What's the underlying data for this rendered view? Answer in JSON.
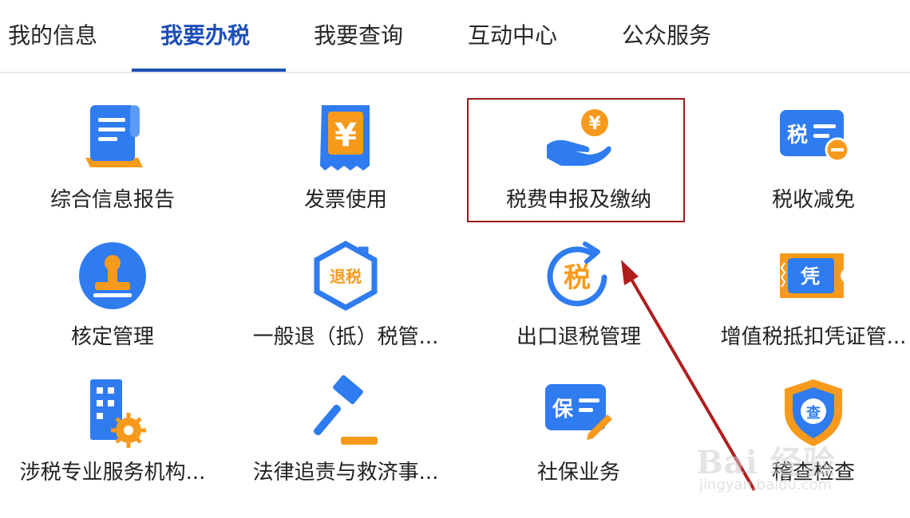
{
  "tabs": [
    {
      "label": "我的信息",
      "active": false
    },
    {
      "label": "我要办税",
      "active": true
    },
    {
      "label": "我要查询",
      "active": false
    },
    {
      "label": "互动中心",
      "active": false
    },
    {
      "label": "公众服务",
      "active": false
    }
  ],
  "tiles": [
    {
      "label": "综合信息报告",
      "icon": "report-document-icon"
    },
    {
      "label": "发票使用",
      "icon": "invoice-receipt-icon",
      "icon_text": "¥"
    },
    {
      "label": "税费申报及缴纳",
      "icon": "hand-coin-payment-icon",
      "icon_text": "¥",
      "highlighted": true
    },
    {
      "label": "税收减免",
      "icon": "tax-reduction-card-icon",
      "icon_text": "税"
    },
    {
      "label": "核定管理",
      "icon": "stamp-icon"
    },
    {
      "label": "一般退（抵）税管...",
      "icon": "tax-refund-hexagon-icon",
      "icon_text": "退税"
    },
    {
      "label": "出口退税管理",
      "icon": "export-tax-refund-icon",
      "icon_text": "税"
    },
    {
      "label": "增值税抵扣凭证管...",
      "icon": "vat-voucher-ticket-icon",
      "icon_text": "凭"
    },
    {
      "label": "涉税专业服务机构...",
      "icon": "building-gear-icon"
    },
    {
      "label": "法律追责与救济事...",
      "icon": "gavel-icon"
    },
    {
      "label": "社保业务",
      "icon": "social-insurance-card-icon",
      "icon_text": "保"
    },
    {
      "label": "稽查检查",
      "icon": "inspection-shield-icon",
      "icon_text": "查"
    }
  ],
  "watermark": {
    "main": "Bai 经验",
    "sub": "jingyan.baidu.com"
  },
  "colors": {
    "accent": "#1d4fb8",
    "icon_blue": "#2f7bf0",
    "icon_orange": "#f79a1b",
    "annotation_red": "#b01e1e"
  }
}
